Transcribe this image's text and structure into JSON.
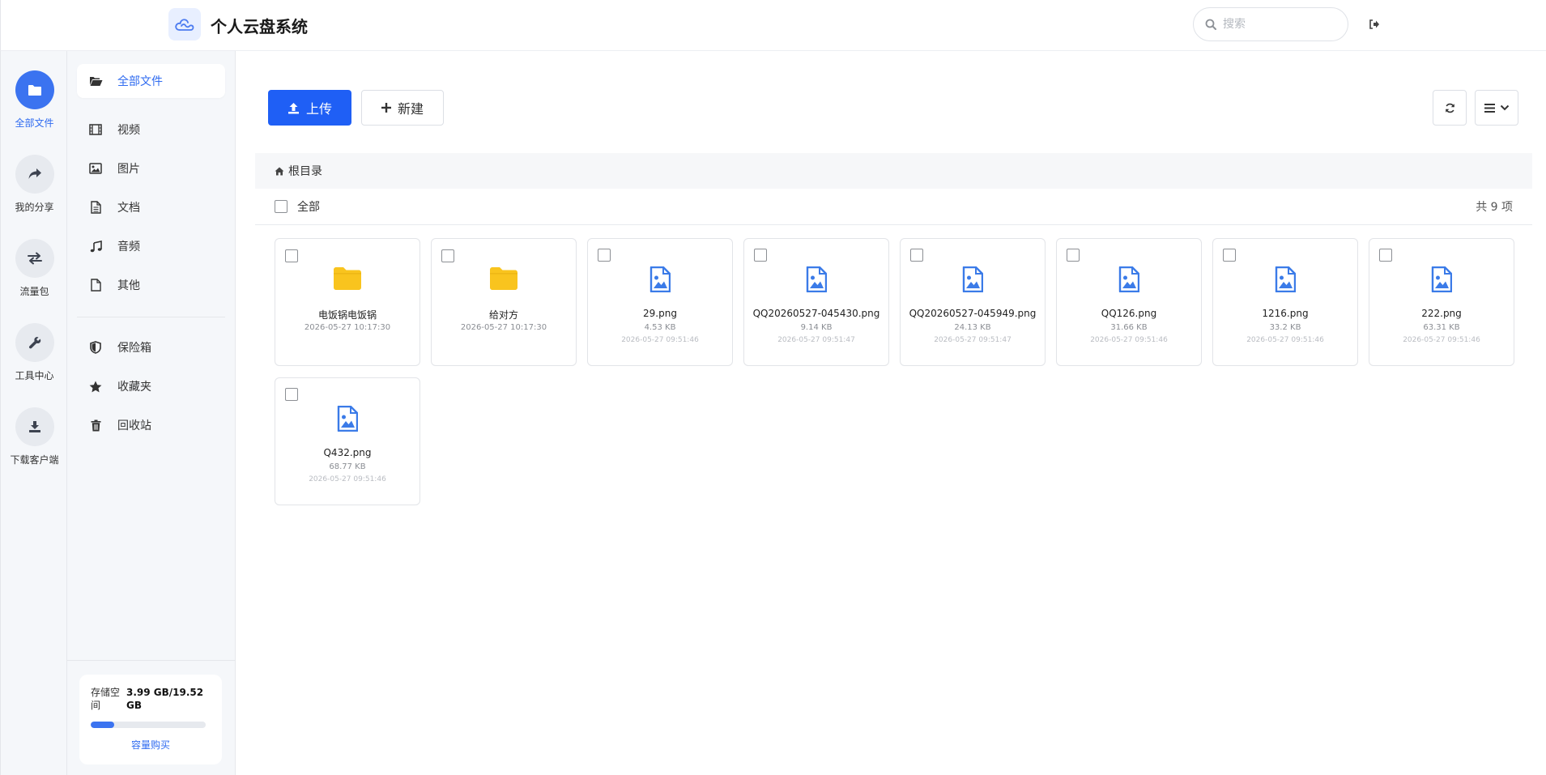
{
  "app": {
    "title": "个人云盘系统"
  },
  "search": {
    "placeholder": "搜索"
  },
  "rail": [
    {
      "label": "全部文件",
      "icon": "folder-icon",
      "active": true
    },
    {
      "label": "我的分享",
      "icon": "share-icon",
      "active": false
    },
    {
      "label": "流量包",
      "icon": "exchange-icon",
      "active": false
    },
    {
      "label": "工具中心",
      "icon": "wrench-icon",
      "active": false
    },
    {
      "label": "下载客户端",
      "icon": "download-icon",
      "active": false
    }
  ],
  "sidebar": {
    "all_files": "全部文件",
    "video": "视频",
    "images": "图片",
    "docs": "文档",
    "audio": "音频",
    "other": "其他",
    "safe": "保险箱",
    "favorites": "收藏夹",
    "recycle": "回收站"
  },
  "storage": {
    "label": "存储空间",
    "value": "3.99 GB/19.52 GB",
    "used_fraction": 0.204,
    "buy_label": "容量购买"
  },
  "toolbar": {
    "upload_label": "上传",
    "new_label": "新建"
  },
  "breadcrumb": {
    "root": "根目录"
  },
  "selection": {
    "all_label": "全部",
    "count_text": "共 9 项"
  },
  "colors": {
    "accent": "#1f5ff5",
    "folder": "#f9c41e",
    "file_icon": "#3b7be8"
  },
  "files": [
    {
      "type": "folder",
      "name": "电饭锅电饭锅",
      "date": "2026-05-27 10:17:30"
    },
    {
      "type": "folder",
      "name": "给对方",
      "date": "2026-05-27 10:17:30"
    },
    {
      "type": "image",
      "name": "29.png",
      "size": "4.53 KB",
      "date": "2026-05-27 09:51:46"
    },
    {
      "type": "image",
      "name": "QQ20260527-045430.png",
      "size": "9.14 KB",
      "date": "2026-05-27 09:51:47"
    },
    {
      "type": "image",
      "name": "QQ20260527-045949.png",
      "size": "24.13 KB",
      "date": "2026-05-27 09:51:47"
    },
    {
      "type": "image",
      "name": "QQ126.png",
      "size": "31.66 KB",
      "date": "2026-05-27 09:51:46"
    },
    {
      "type": "image",
      "name": "1216.png",
      "size": "33.2 KB",
      "date": "2026-05-27 09:51:46"
    },
    {
      "type": "image",
      "name": "222.png",
      "size": "63.31 KB",
      "date": "2026-05-27 09:51:46"
    },
    {
      "type": "image",
      "name": "Q432.png",
      "size": "68.77 KB",
      "date": "2026-05-27 09:51:46"
    }
  ]
}
